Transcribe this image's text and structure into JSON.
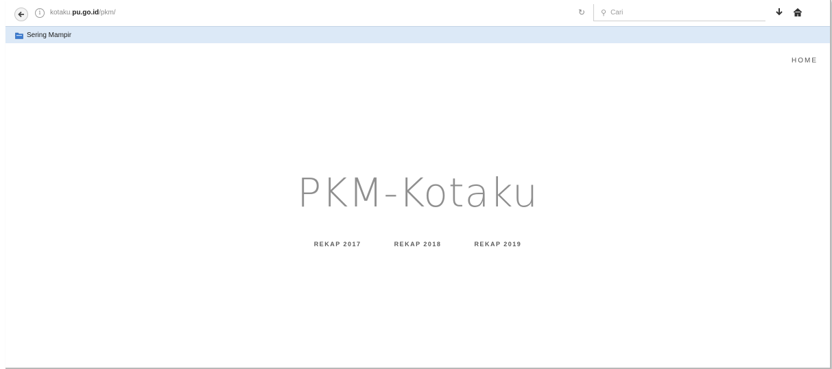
{
  "browser": {
    "url_prefix": "kotaku.",
    "url_domain": "pu.go.id",
    "url_path": "/pkm/",
    "search_placeholder": "Cari",
    "bookmarks": [
      {
        "label": "Sering Mampir",
        "icon": "bookmark-folder-icon"
      }
    ],
    "icons": [
      "back-arrow-icon",
      "site-info-icon",
      "reload-icon",
      "search-icon",
      "download-icon",
      "home-icon"
    ]
  },
  "site": {
    "nav": {
      "home_label": "HOME"
    },
    "title": "PKM-Kotaku",
    "links": [
      {
        "label": "REKAP 2017"
      },
      {
        "label": "REKAP 2018"
      },
      {
        "label": "REKAP 2019"
      }
    ]
  },
  "colors": {
    "bookmark_bar": "#dce9f7",
    "title_text": "#8a8a8a",
    "link_text": "#5c5c5c",
    "page_background": "#ffffff"
  }
}
